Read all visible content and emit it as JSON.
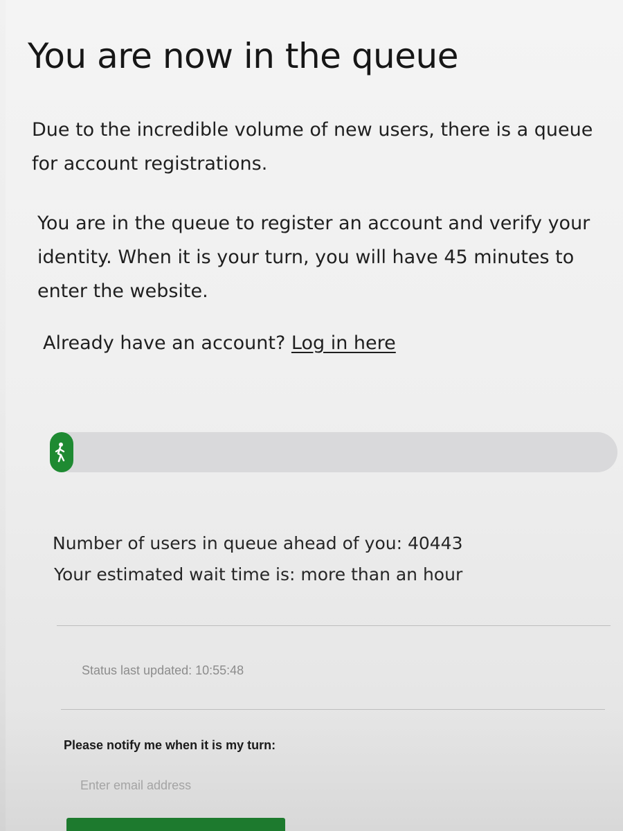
{
  "header": {
    "title": "You are now in the queue"
  },
  "intro": {
    "paragraph1": "Due to the incredible volume of new users, there is a queue for account registrations.",
    "paragraph2": "You are in the queue to register an account and verify your identity. When it is your turn, you will have 45 minutes to enter the website."
  },
  "login": {
    "prompt": "Already have an account?",
    "link_label": "Log in here"
  },
  "progress": {
    "value_fraction": 0.0,
    "color": "#1e8a32",
    "track_color": "#d9d9db",
    "icon": "walking-person-icon"
  },
  "queue": {
    "ahead_label": "Number of users in queue ahead of you:",
    "ahead_count": "40443",
    "wait_label": "Your estimated wait time is:",
    "wait_value": "more than an hour"
  },
  "status": {
    "updated_label": "Status last updated:",
    "updated_time": "10:55:48"
  },
  "notify": {
    "label": "Please notify me when it is my turn:",
    "email_placeholder": "Enter email address"
  }
}
